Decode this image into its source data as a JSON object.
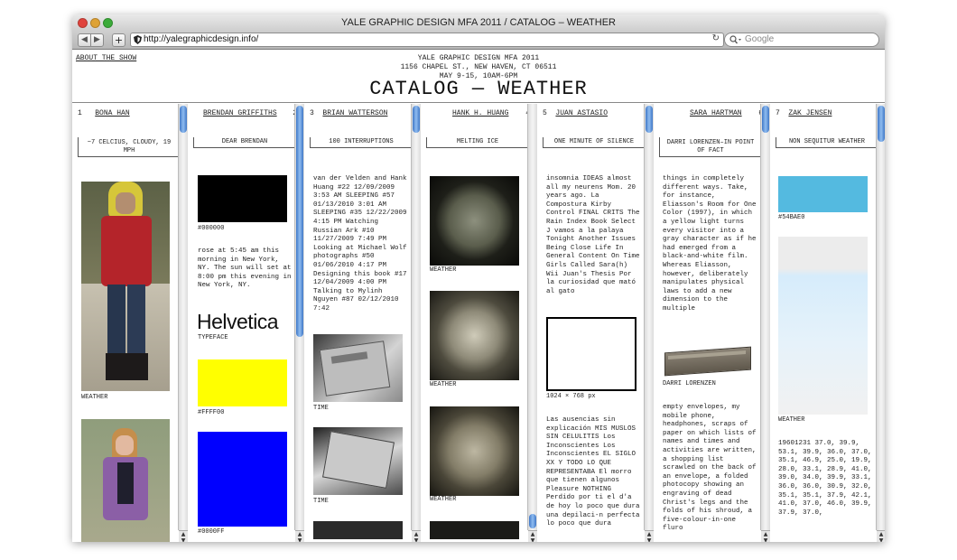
{
  "window": {
    "title": "YALE GRAPHIC DESIGN MFA 2011 / CATALOG – WEATHER",
    "url": "http://yalegraphicdesign.info/",
    "search_placeholder": "Google"
  },
  "page": {
    "about_link": "ABOUT THE SHOW",
    "header_lines": [
      "YALE GRAPHIC DESIGN MFA 2011",
      "1156 CHAPEL ST., NEW HAVEN, CT 06511",
      "MAY 9-15, 10AM-6PM"
    ],
    "title": "CATALOG — WEATHER"
  },
  "columns": [
    {
      "number": "1",
      "author": "BONA HAN",
      "work": "~7 CELCIUS, CLOUDY, 19 MPH",
      "items": [
        {
          "caption": "WEATHER"
        }
      ]
    },
    {
      "number": "2",
      "author": "BRENDAN GRIFFITHS",
      "work": "DEAR BRENDAN",
      "items": [
        {
          "caption": "#000000",
          "color": "#000000"
        },
        {
          "text": "rose at 5:45 am this morning in New York, NY. The sun will set at 8:00 pm this evening in New York, NY."
        },
        {
          "title": "Helvetica",
          "caption": "TYPEFACE"
        },
        {
          "caption": "#FFFF00",
          "color": "#FFFF00"
        },
        {
          "caption": "#0000FF",
          "color": "#0000FF"
        }
      ]
    },
    {
      "number": "3",
      "author": "BRIAN WATTERSON",
      "work": "100 INTERRUPTIONS",
      "items": [
        {
          "text": "van der Velden and Hank Huang #22 12/09/2009 3:53 AM SLEEPING #57 01/13/2010 3:01 AM SLEEPING #35 12/22/2009 4:15 PM Watching Russian Ark #10 11/27/2009 7:49 PM Looking at Michael Wolf photographs #50 01/06/2010 4:17 PM Designing this book #17 12/04/2009 4:00 PM Talking to Mylinh Nguyen #87 02/12/2010 7:42"
        },
        {
          "caption": "TIME"
        },
        {
          "caption": "TIME"
        }
      ]
    },
    {
      "number": "4",
      "author": "HANK H. HUANG",
      "work": "MELTING ICE",
      "items": [
        {
          "caption": "WEATHER"
        },
        {
          "caption": "WEATHER"
        },
        {
          "caption": "WEATHER"
        }
      ]
    },
    {
      "number": "5",
      "author": "JUAN ASTASIO",
      "work": "ONE MINUTE OF SILENCE",
      "items": [
        {
          "text": "insomnia IDEAS almost all my neurens Mom. 20 years ago. La Compostura Kirby Control FINAL CRITS The Rain Index Book Select J vamos a la palaya Tonight Another Issues Being Close Life In General Content On Time Girls Called Sara(h) Wii Juan's Thesis Por la curiosidad que mató al gato"
        },
        {
          "caption": "1024 × 768 px"
        },
        {
          "text": "Las ausencias sin explicación MIS MUSLOS SIN CELULITIS Los Inconscientes Los Inconscientes EL SIGLO XX Y TODO LO QUE REPRESENTABA El morro que tienen algunos Pleasure NOTHING Perdido por ti el d'a de hoy lo poco que dura una depilaci-n perfecta lo poco que dura"
        }
      ]
    },
    {
      "number": "6",
      "author": "SARA HARTMAN",
      "work": "DARRI LORENZEN–IN POINT OF FACT",
      "items": [
        {
          "text": "things in completely different ways. Take, for instance, Eliasson's Room for One Color (1997), in which a yellow light turns every visitor into a gray character as if he had emerged from a black-and-white film. Whereas Eliasson, however, deliberately manipulates physical laws to add a new dimension to the multiple"
        },
        {
          "caption": "DARRI LORENZEN"
        },
        {
          "text": "empty envelopes, my mobile phone, headphones, scraps of paper on which lists of names and times and activities are written, a shopping list scrawled on the back of an envelope, a folded photocopy showing an engraving of dead Christ's legs and the folds of his shroud, a five-colour-in-one fluro"
        }
      ]
    },
    {
      "number": "7",
      "author": "ZAK JENSEN",
      "work": "NON SEQUITUR WEATHER",
      "items": [
        {
          "caption": "#54BAE0",
          "color": "#54BAE0"
        },
        {
          "caption": "WEATHER"
        },
        {
          "text": "19601231 37.0, 39.9, 53.1, 39.9, 36.0, 37.0, 35.1, 46.9, 25.0, 19.9, 28.0, 33.1, 28.9, 41.0, 39.0, 34.0, 39.9, 33.1, 36.0, 36.0, 30.9, 32.0, 35.1, 35.1, 37.9, 42.1, 41.0, 37.0, 46.0, 39.9, 37.9, 37.0,"
        }
      ]
    }
  ]
}
